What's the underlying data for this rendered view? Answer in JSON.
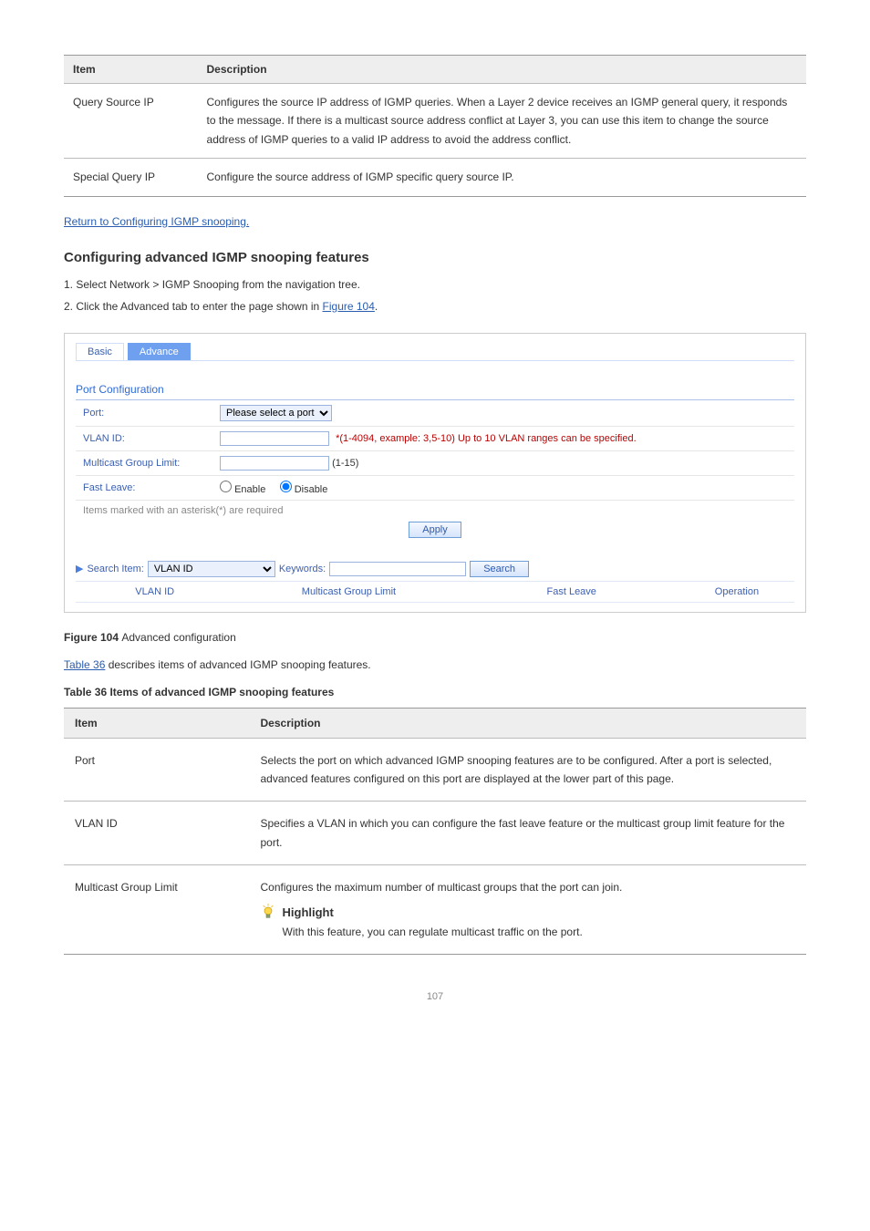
{
  "page_number": "107",
  "top_table": {
    "head_item": "Item",
    "head_desc": "Description",
    "rows": [
      {
        "item": "Query Source IP",
        "desc": "Configures the source IP address of IGMP queries. When a Layer 2 device receives an IGMP general query, it responds to the message. If there is a multicast source address conflict at Layer 3, you can use this item to change the source address of IGMP queries to a valid IP address to avoid the address conflict."
      },
      {
        "item": "Special Query IP",
        "desc": "Configure the source address of IGMP specific query source IP."
      }
    ]
  },
  "return_link": "Return to Configuring IGMP snooping.",
  "heading_advanced": "Configuring advanced IGMP snooping features",
  "instr_1": "1. Select Network > IGMP Snooping from the navigation tree.",
  "instr_2_pre": "2. Click the Advanced tab to enter the page shown in ",
  "instr_2_link": "Figure 104",
  "instr_2_post": ".",
  "ui": {
    "tab_basic": "Basic",
    "tab_advanced": "Advance",
    "section_title": "Port Configuration",
    "row_port_label": "Port:",
    "port_select": "Please select a port",
    "row_vlan_label": "VLAN ID:",
    "vlan_hint": "*(1-4094, example: 3,5-10) Up to 10 VLAN ranges can be specified.",
    "row_mgl_label": "Multicast Group Limit:",
    "mgl_hint": "(1-15)",
    "row_fastleave_label": "Fast Leave:",
    "enable": "Enable",
    "disable": "Disable",
    "note": "Items marked with an asterisk(*) are required",
    "apply": "Apply",
    "search_item_label": "Search Item:",
    "search_select": "VLAN ID",
    "keywords_label": "Keywords:",
    "search_btn": "Search",
    "col_vlan": "VLAN ID",
    "col_mgl": "Multicast Group Limit",
    "col_fl": "Fast Leave",
    "col_op": "Operation"
  },
  "figure_caption_num": "Figure 104 ",
  "figure_caption_text": "Advanced configuration",
  "table_caption_link": "Table 36",
  "table_caption_text": " describes items of advanced IGMP snooping features.",
  "table_title": "Table 36 Items of advanced IGMP snooping features",
  "adv_table": {
    "head_item": "Item",
    "head_desc": "Description",
    "rows": [
      {
        "item": "Port",
        "desc": "Selects the port on which advanced IGMP snooping features are to be configured. After a port is selected, advanced features configured on this port are displayed at the lower part of this page.",
        "highlight": ""
      },
      {
        "item": "VLAN ID",
        "desc": "Specifies a VLAN in which you can configure the fast leave feature or the multicast group limit feature for the port.",
        "highlight": ""
      },
      {
        "item": "Multicast Group Limit",
        "desc": "Configures the maximum number of multicast groups that the port can join.",
        "highlight": "With this feature, you can regulate multicast traffic on the port."
      }
    ]
  }
}
